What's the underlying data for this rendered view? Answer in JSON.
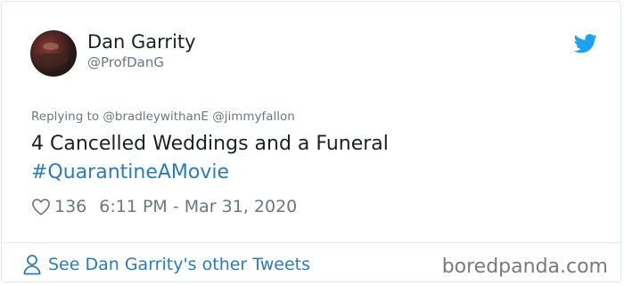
{
  "author": {
    "name": "Dan Garrity",
    "handle": "@ProfDanG"
  },
  "reply": {
    "text": "Replying to @bradleywithanE @jimmyfallon"
  },
  "tweet": {
    "text": "4 Cancelled Weddings and a Funeral",
    "hashtag": "#QuarantineAMovie"
  },
  "meta": {
    "likes": "136",
    "timestamp": "6:11 PM - Mar 31, 2020"
  },
  "footer": {
    "see_other": "See Dan Garrity's other Tweets",
    "watermark": "boredpanda.com"
  },
  "colors": {
    "link": "#2b7bb9",
    "muted": "#697882",
    "twitter_blue": "#1da1f2"
  },
  "icons": [
    "avatar",
    "twitter-bird-icon",
    "heart-icon",
    "person-icon"
  ]
}
